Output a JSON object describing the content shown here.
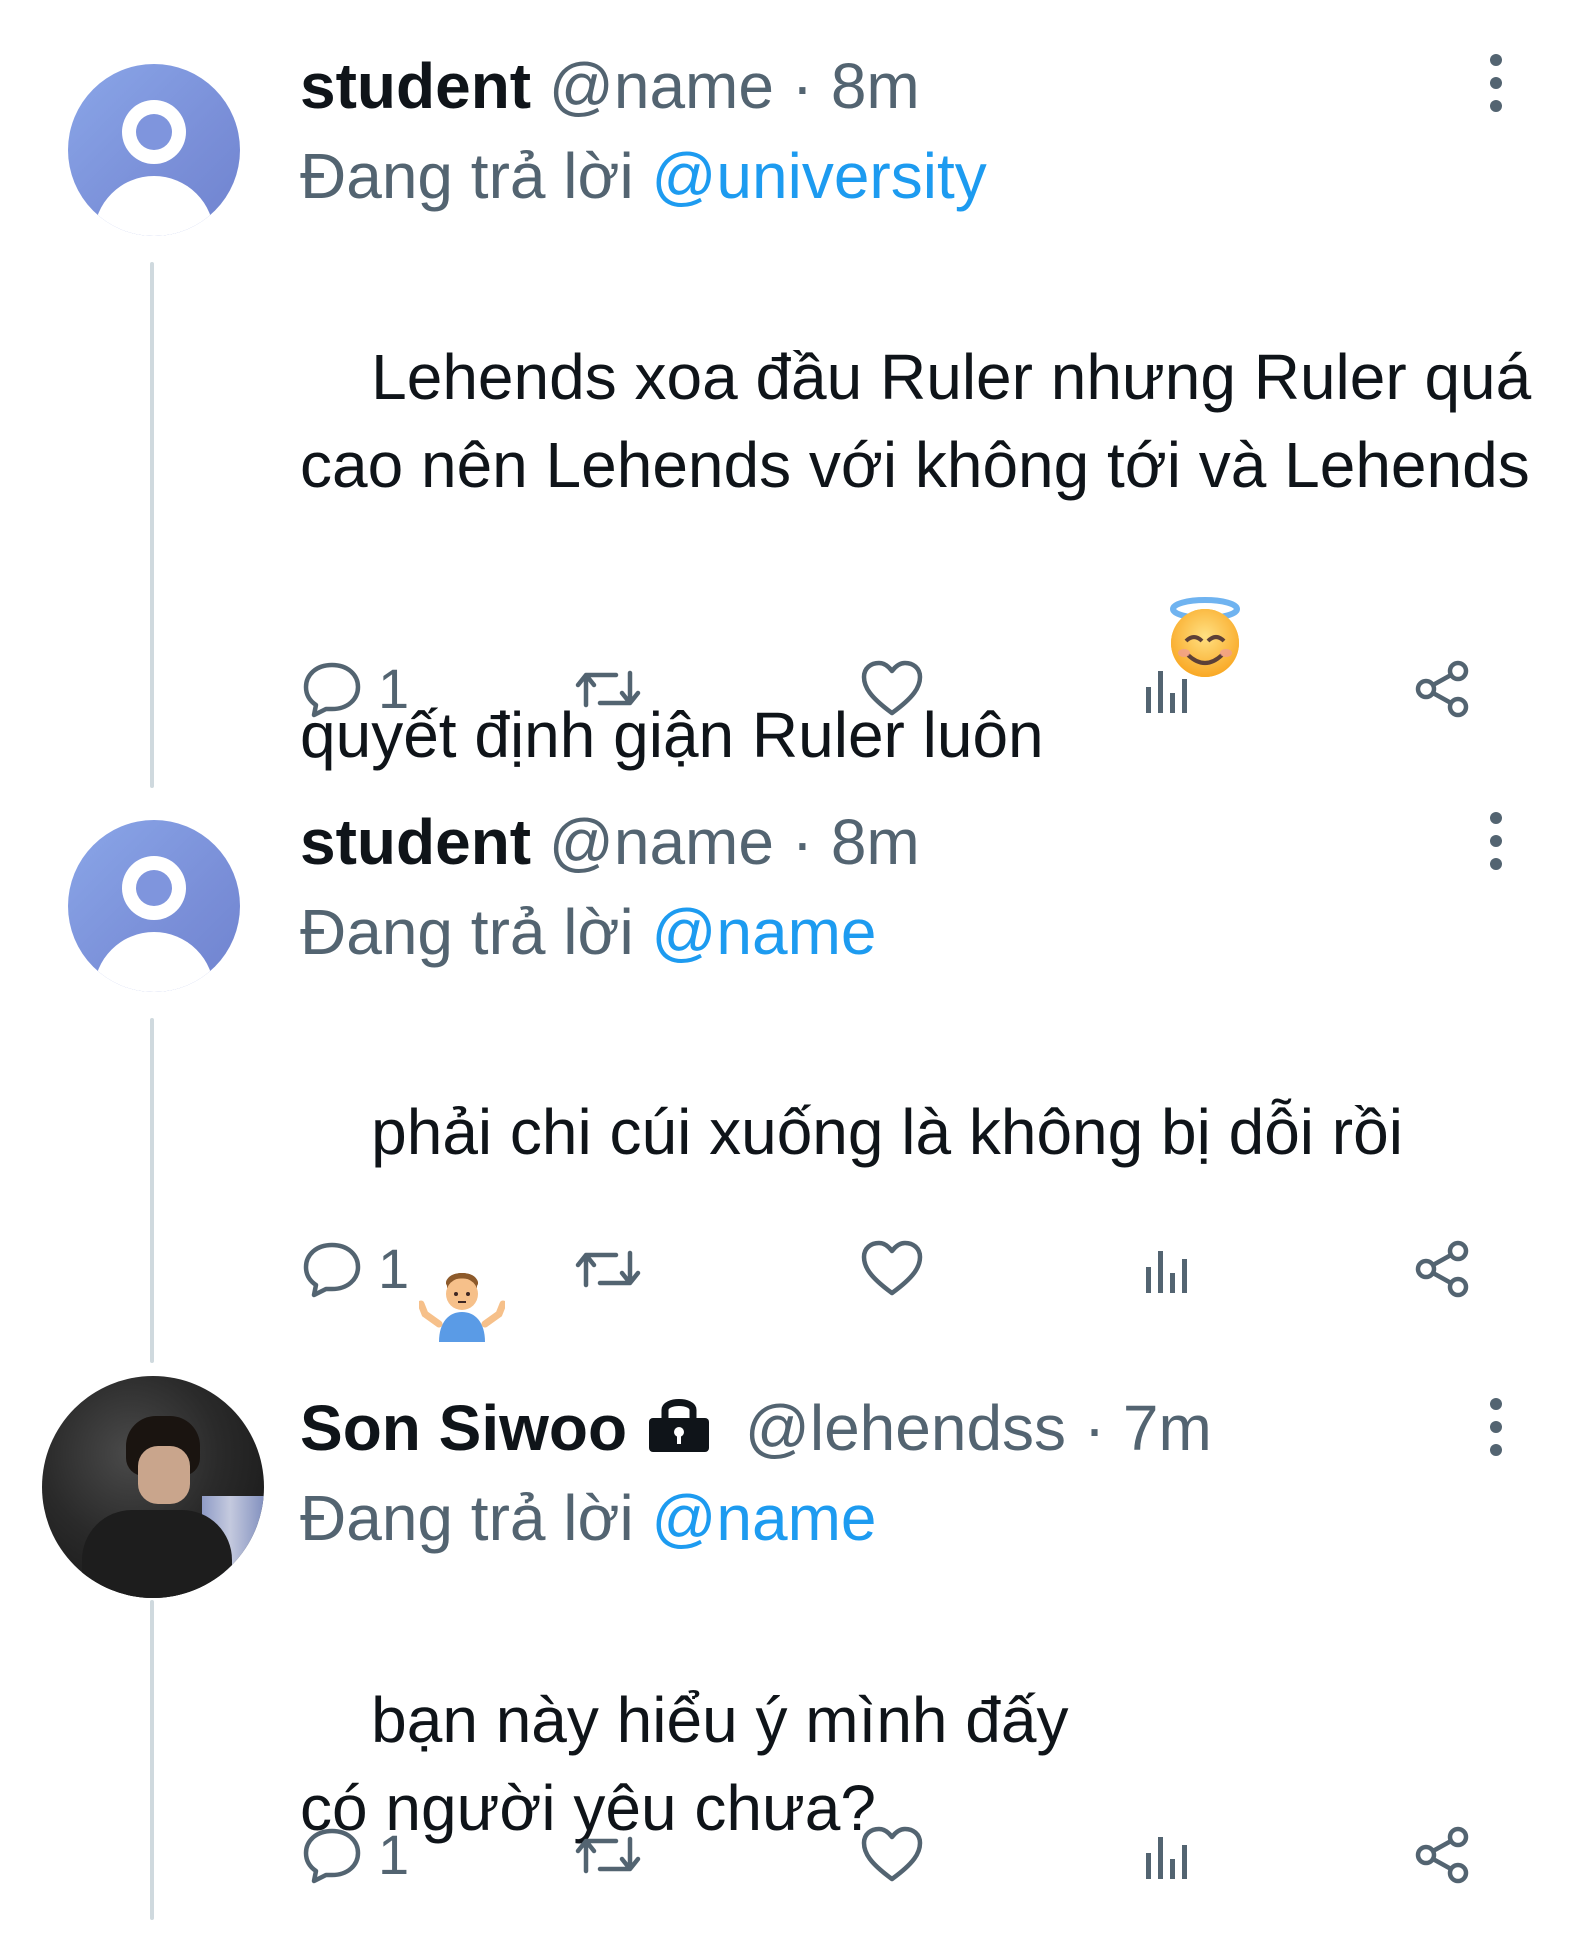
{
  "colors": {
    "text_primary": "#0f1419",
    "text_secondary": "#536471",
    "mention": "#1d9bf0",
    "thread_line": "#cfd9de"
  },
  "tweets": [
    {
      "display_name": "student",
      "handle": "@name",
      "separator": "·",
      "time": "8m",
      "replying_prefix": "Đang trả lời",
      "replying_to": "@university",
      "text": "Lehends xoa đầu Ruler nhưng Ruler quá cao nên Lehends với không tới và Lehends quyết định giận Ruler luôn",
      "emoji": "smiling-face-with-halo",
      "reply_count": "1",
      "avatar": "default-avatar",
      "locked": false
    },
    {
      "display_name": "student",
      "handle": "@name",
      "separator": "·",
      "time": "8m",
      "replying_prefix": "Đang trả lời",
      "replying_to": "@name",
      "text": "phải chi cúi xuống là không bị dỗi rồi",
      "emoji": "person-shrugging",
      "reply_count": "1",
      "avatar": "default-avatar",
      "locked": false
    },
    {
      "display_name": "Son Siwoo",
      "handle": "@lehendss",
      "separator": "·",
      "time": "7m",
      "replying_prefix": "Đang trả lời",
      "replying_to": "@name",
      "text": "bạn này hiểu ý mình đấy\ncó người yêu chưa?",
      "emoji": "",
      "reply_count": "1",
      "avatar": "photo-avatar",
      "locked": true
    }
  ]
}
